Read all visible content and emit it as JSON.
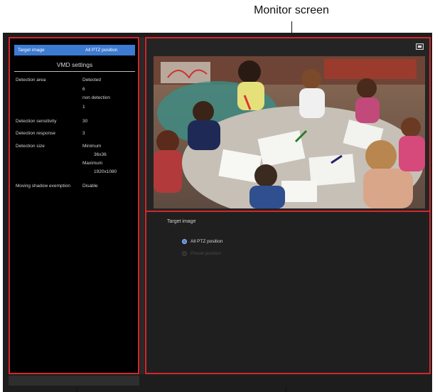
{
  "annotation": {
    "monitor_label": "Monitor screen"
  },
  "left_panel": {
    "target_image_label": "Target image",
    "target_image_value": "All PTZ position",
    "section_title": "VMD settings",
    "settings": [
      {
        "label": "Detection area",
        "values": [
          "Detected",
          "6",
          "non detection",
          "1"
        ]
      },
      {
        "label": "Detection sensitivity",
        "values": [
          "30"
        ]
      },
      {
        "label": "Detection response",
        "values": [
          "3"
        ]
      },
      {
        "label": "Detection size",
        "values": [
          "Minimum",
          "36x36",
          "Maximum",
          "1920x1080"
        ]
      },
      {
        "label": "Moving shadow exemption",
        "values": [
          "Disable"
        ]
      }
    ]
  },
  "right_panel": {
    "fullscreen_icon": "fullscreen-icon",
    "target_heading": "Target image",
    "options": [
      {
        "label": "All PTZ position",
        "selected": true,
        "enabled": true
      },
      {
        "label": "Preset position",
        "selected": false,
        "enabled": false
      }
    ]
  },
  "colors": {
    "accent": "#3d7bd2",
    "highlight_border": "#d4262a",
    "panel_bg": "#000000",
    "app_bg": "#1d1d1d"
  }
}
